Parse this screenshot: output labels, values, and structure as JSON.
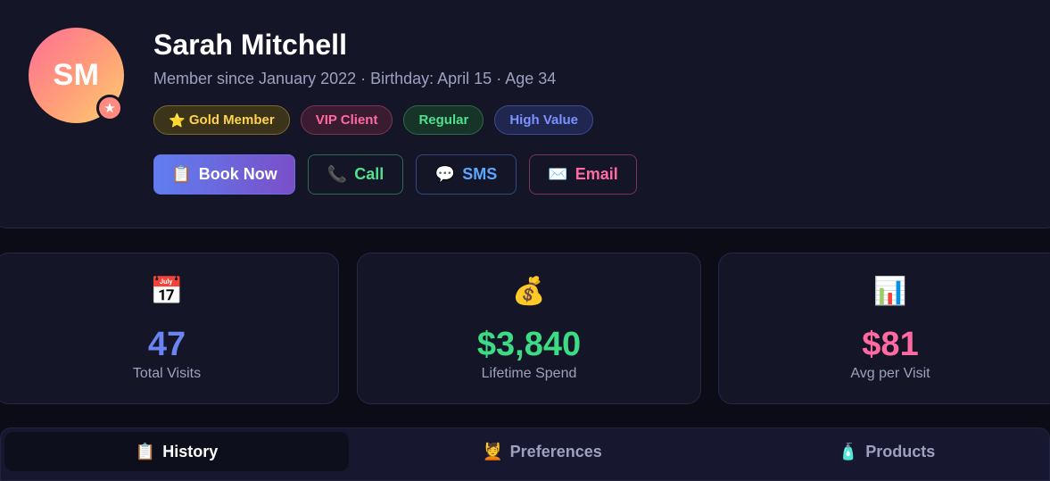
{
  "profile": {
    "initials": "SM",
    "name": "Sarah Mitchell",
    "meta": "Member since January 2022 · Birthday: April 15 · Age 34",
    "badge_icon": "star-icon",
    "tags": [
      {
        "icon": "⭐",
        "label": "Gold Member"
      },
      {
        "label": "VIP Client"
      },
      {
        "label": "Regular"
      },
      {
        "label": "High Value"
      }
    ]
  },
  "actions": {
    "book": {
      "icon": "📋",
      "label": "Book Now"
    },
    "call": {
      "icon": "📞",
      "label": "Call"
    },
    "sms": {
      "icon": "💬",
      "label": "SMS"
    },
    "email": {
      "icon": "✉️",
      "label": "Email"
    }
  },
  "stats": [
    {
      "icon": "📅",
      "value": "47",
      "label": "Total Visits",
      "color": "#6b84f4"
    },
    {
      "icon": "💰",
      "value": "$3,840",
      "label": "Lifetime Spend",
      "color": "#3ddc84"
    },
    {
      "icon": "📊",
      "value": "$81",
      "label": "Avg per Visit",
      "color": "#ff6aa0"
    }
  ],
  "tabs": [
    {
      "icon": "📋",
      "label": "History",
      "active": true
    },
    {
      "icon": "💆",
      "label": "Preferences",
      "active": false
    },
    {
      "icon": "🧴",
      "label": "Products",
      "active": false
    }
  ],
  "colors": {
    "accent_gradient_start": "#5f7ef0",
    "accent_gradient_end": "#7a4fc8",
    "background": "#0b0c15",
    "card": "#141527"
  }
}
